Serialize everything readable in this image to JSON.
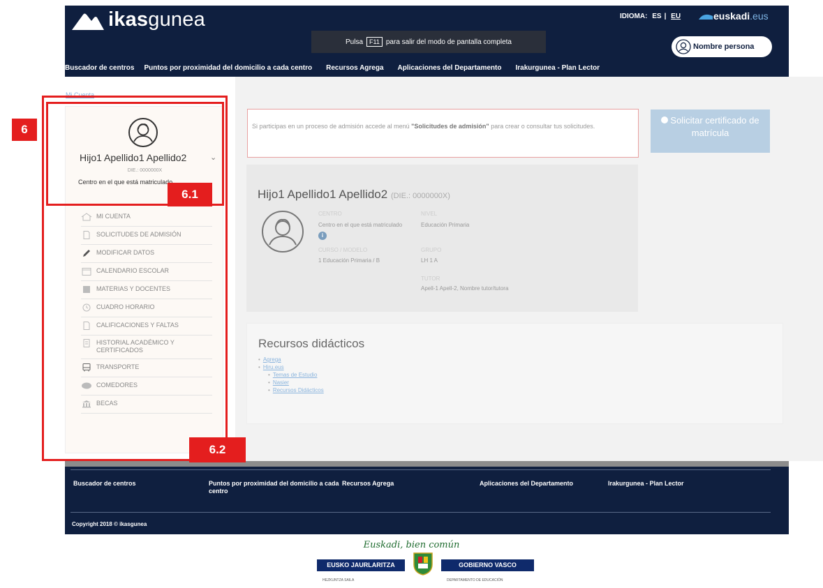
{
  "header": {
    "logo_bold": "ikas",
    "logo_light": "gunea",
    "lang_label": "IDIOMA:",
    "lang_es": "ES",
    "lang_eu": "EU",
    "euskadi_bold": "euskadi",
    "euskadi_suffix": ".eus",
    "fullscreen_pre": "Pulsa",
    "fullscreen_key": "F11",
    "fullscreen_post": "para salir del modo de pantalla completa",
    "user_name": "Nombre persona",
    "nav": [
      "Buscador de centros",
      "Puntos por proximidad del domicilio a cada centro",
      "Recursos Agrega",
      "Aplicaciones del Departamento",
      "Irakurgunea - Plan Lector"
    ]
  },
  "breadcrumb": "Mi Cuenta",
  "sidebar": {
    "student_name": "Hijo1 Apellido1 Apellido2",
    "dni": "DIE.: 0000000X",
    "centro": "Centro en el que está matriculado",
    "menu": [
      "MI CUENTA",
      "SOLICITUDES DE ADMISIÓN",
      "MODIFICAR DATOS",
      "CALENDARIO ESCOLAR",
      "MATERIAS Y DOCENTES",
      "CUADRO HORARIO",
      "CALIFICACIONES Y FALTAS",
      "HISTORIAL ACADÉMICO Y CERTIFICADOS",
      "TRANSPORTE",
      "COMEDORES",
      "BECAS"
    ]
  },
  "annotations": {
    "outer": "6",
    "profile": "6.1",
    "menu": "6.2"
  },
  "alert": {
    "pre": "Si participas en un proceso de admisión accede al menú ",
    "bold": "\"Solicitudes de admisión\"",
    "post": " para crear o consultar tus solicitudes."
  },
  "certificate_button": "Solicitar certificado de matrícula",
  "card": {
    "name": "Hijo1 Apellido1 Apellido2",
    "dni": "(DIE.: 0000000X)",
    "centro_label": "CENTRO",
    "centro_value": "Centro en el que está matriculado",
    "nivel_label": "NIVEL",
    "nivel_value": "Educación Primaria",
    "curso_label": "CURSO / MODELO",
    "curso_value": "1 Educación Primaria  /  B",
    "grupo_label": "GRUPO",
    "grupo_value": "LH 1 A",
    "tutor_label": "TUTOR",
    "tutor_value": "Apell-1 Apell-2, Nombre tutor/tutora"
  },
  "recursos": {
    "title": "Recursos didácticos",
    "items": [
      "Agrega",
      "Hiru.eus"
    ],
    "subitems": [
      "Temas de Estudio",
      "Nasier",
      "Recursos Didácticos"
    ]
  },
  "footer": {
    "nav": [
      "Buscador de centros",
      "Puntos por proximidad del domicilio a cada centro",
      "Recursos Agrega",
      "Aplicaciones del Departamento",
      "Irakurgunea - Plan Lector"
    ],
    "copyright": "Copyright 2018 © ikasgunea"
  },
  "gov": {
    "tagline": "Euskadi, bien común",
    "left": "EUSKO JAURLARITZA",
    "right": "GOBIERNO VASCO",
    "left_sub": "HEZKUNTZA SAILA",
    "right_sub": "DEPARTAMENTO DE EDUCACIÓN"
  }
}
